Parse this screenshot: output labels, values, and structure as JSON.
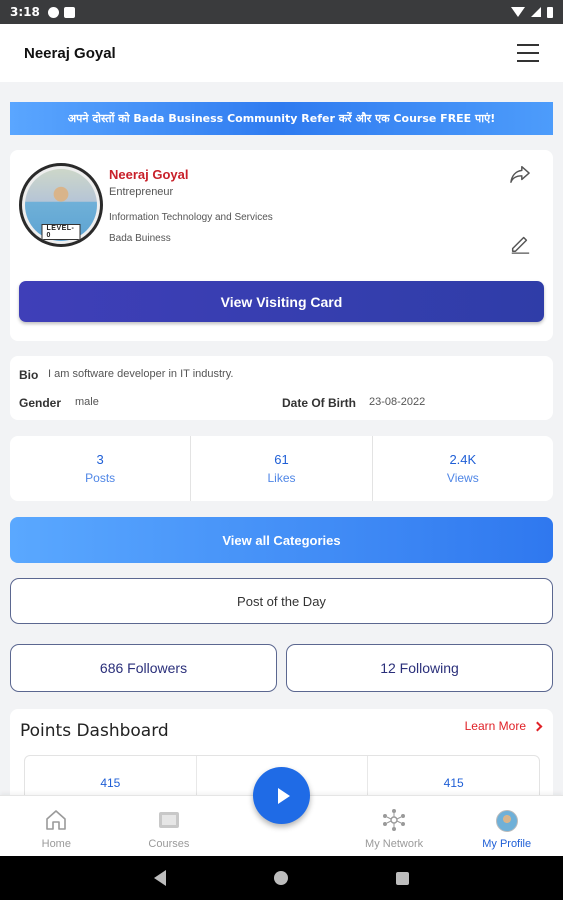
{
  "status_bar": {
    "time": "3:18"
  },
  "app_bar": {
    "title": "Neeraj Goyal"
  },
  "banner": {
    "text": "अपने दोस्तों को Bada Business Community Refer करें और एक Course FREE पाएं!"
  },
  "profile": {
    "name": "Neeraj Goyal",
    "role": "Entrepreneur",
    "industry": "Information Technology and Services",
    "company": "Bada Buiness",
    "level": "LEVEL-0",
    "visiting_card_label": "View Visiting Card"
  },
  "bio": {
    "bio_label": "Bio",
    "bio_value": "I am software developer in IT industry.",
    "gender_label": "Gender",
    "gender_value": "male",
    "dob_label": "Date Of Birth",
    "dob_value": "23-08-2022"
  },
  "stats": [
    {
      "value": "3",
      "label": "Posts"
    },
    {
      "value": "61",
      "label": "Likes"
    },
    {
      "value": "2.4K",
      "label": "Views"
    }
  ],
  "buttons": {
    "view_categories": "View all Categories",
    "post_of_day": "Post of the Day",
    "followers": "686 Followers",
    "following": "12 Following"
  },
  "points": {
    "title": "Points Dashboard",
    "learn_more": "Learn More",
    "values": [
      "415",
      "",
      "415"
    ]
  },
  "bottom_nav": [
    {
      "label": "Home",
      "icon": "home-icon"
    },
    {
      "label": "Courses",
      "icon": "courses-icon"
    },
    {
      "label": "",
      "icon": "play-icon"
    },
    {
      "label": "My Network",
      "icon": "network-icon"
    },
    {
      "label": "My Profile",
      "icon": "profile-avatar"
    }
  ],
  "colors": {
    "primary_blue": "#1f6be6",
    "visiting_card": "#3a3db3",
    "name_red": "#c8202a",
    "learn_more_red": "#e02127"
  }
}
